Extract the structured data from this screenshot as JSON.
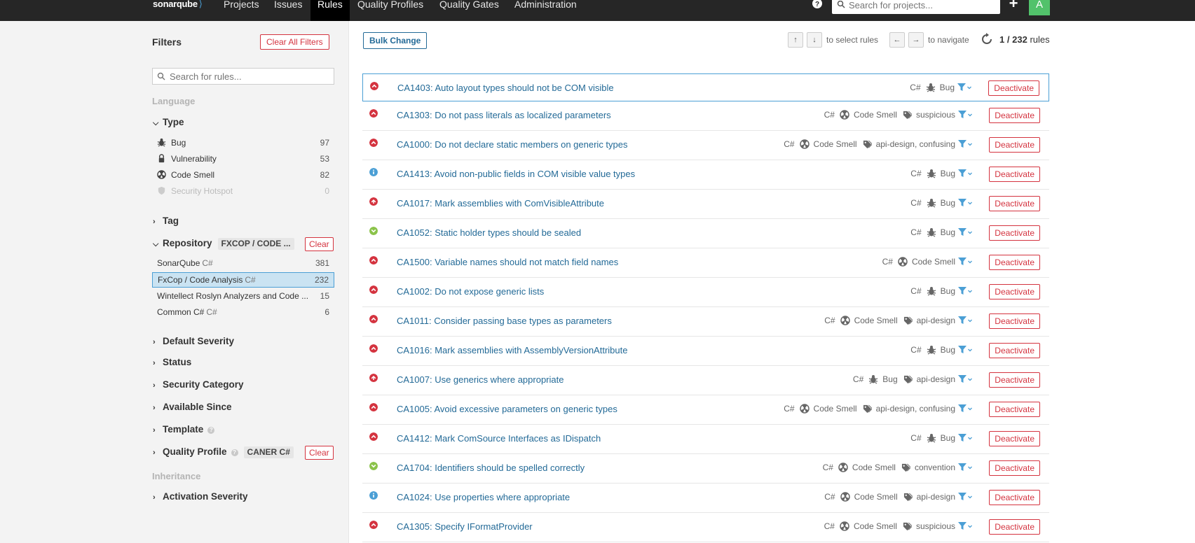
{
  "nav": {
    "logo": "sonarqube",
    "links": [
      "Projects",
      "Issues",
      "Rules",
      "Quality Profiles",
      "Quality Gates",
      "Administration"
    ],
    "active": "Rules",
    "search_placeholder": "Search for projects...",
    "plus": "+",
    "avatar": "A"
  },
  "sidebar": {
    "title": "Filters",
    "clear_all": "Clear All Filters",
    "search_placeholder": "Search for rules...",
    "language_label": "Language",
    "type": {
      "label": "Type",
      "items": [
        {
          "label": "Bug",
          "count": "97",
          "icon": "bug-icon"
        },
        {
          "label": "Vulnerability",
          "count": "53",
          "icon": "lock-icon"
        },
        {
          "label": "Code Smell",
          "count": "82",
          "icon": "code-smell-icon"
        },
        {
          "label": "Security Hotspot",
          "count": "0",
          "icon": "shield-icon"
        }
      ]
    },
    "tag_label": "Tag",
    "repository": {
      "label": "Repository",
      "chip": "FXCOP / CODE ...",
      "clear": "Clear",
      "items": [
        {
          "label": "SonarQube",
          "lang": "C#",
          "count": "381"
        },
        {
          "label": "FxCop / Code Analysis",
          "lang": "C#",
          "count": "232"
        },
        {
          "label": "Wintellect Roslyn Analyzers and Code ...",
          "lang": "",
          "count": "15"
        },
        {
          "label": "Common C#",
          "lang": "C#",
          "count": "6"
        }
      ]
    },
    "facets": [
      "Default Severity",
      "Status",
      "Security Category",
      "Available Since",
      "Template"
    ],
    "quality_profile": {
      "label": "Quality Profile",
      "chip": "CANER C#",
      "clear": "Clear"
    },
    "inheritance_label": "Inheritance",
    "activation_severity": "Activation Severity"
  },
  "toolbar": {
    "bulk_change": "Bulk Change",
    "up": "↑",
    "down": "↓",
    "select_label": "to select rules",
    "left": "←",
    "right": "→",
    "navigate_label": "to navigate",
    "count_current": "1",
    "count_total": "232",
    "count_suffix": "rules"
  },
  "colors": {
    "major": "#d4333f",
    "info": "#4b9fd5",
    "minor": "#8bc34a",
    "link": "#236a97"
  },
  "rules": [
    {
      "title": "CA1403: Auto layout types should not be COM visible",
      "severity": "major",
      "lang": "C#",
      "type": "Bug",
      "tags": ""
    },
    {
      "title": "CA1303: Do not pass literals as localized parameters",
      "severity": "major",
      "lang": "C#",
      "type": "Code Smell",
      "tags": "suspicious"
    },
    {
      "title": "CA1000: Do not declare static members on generic types",
      "severity": "major",
      "lang": "C#",
      "type": "Code Smell",
      "tags": "api-design, confusing"
    },
    {
      "title": "CA1413: Avoid non-public fields in COM visible value types",
      "severity": "info",
      "lang": "C#",
      "type": "Bug",
      "tags": ""
    },
    {
      "title": "CA1017: Mark assemblies with ComVisibleAttribute",
      "severity": "critical",
      "lang": "C#",
      "type": "Bug",
      "tags": ""
    },
    {
      "title": "CA1052: Static holder types should be sealed",
      "severity": "minor",
      "lang": "C#",
      "type": "Bug",
      "tags": ""
    },
    {
      "title": "CA1500: Variable names should not match field names",
      "severity": "major",
      "lang": "C#",
      "type": "Code Smell",
      "tags": ""
    },
    {
      "title": "CA1002: Do not expose generic lists",
      "severity": "major",
      "lang": "C#",
      "type": "Bug",
      "tags": ""
    },
    {
      "title": "CA1011: Consider passing base types as parameters",
      "severity": "major",
      "lang": "C#",
      "type": "Code Smell",
      "tags": "api-design"
    },
    {
      "title": "CA1016: Mark assemblies with AssemblyVersionAttribute",
      "severity": "major",
      "lang": "C#",
      "type": "Bug",
      "tags": ""
    },
    {
      "title": "CA1007: Use generics where appropriate",
      "severity": "critical",
      "lang": "C#",
      "type": "Bug",
      "tags": "api-design"
    },
    {
      "title": "CA1005: Avoid excessive parameters on generic types",
      "severity": "major",
      "lang": "C#",
      "type": "Code Smell",
      "tags": "api-design, confusing"
    },
    {
      "title": "CA1412: Mark ComSource Interfaces as IDispatch",
      "severity": "major",
      "lang": "C#",
      "type": "Bug",
      "tags": ""
    },
    {
      "title": "CA1704: Identifiers should be spelled correctly",
      "severity": "minor",
      "lang": "C#",
      "type": "Code Smell",
      "tags": "convention"
    },
    {
      "title": "CA1024: Use properties where appropriate",
      "severity": "info",
      "lang": "C#",
      "type": "Code Smell",
      "tags": "api-design"
    },
    {
      "title": "CA1305: Specify IFormatProvider",
      "severity": "major",
      "lang": "C#",
      "type": "Code Smell",
      "tags": "suspicious"
    }
  ],
  "deactivate_label": "Deactivate"
}
